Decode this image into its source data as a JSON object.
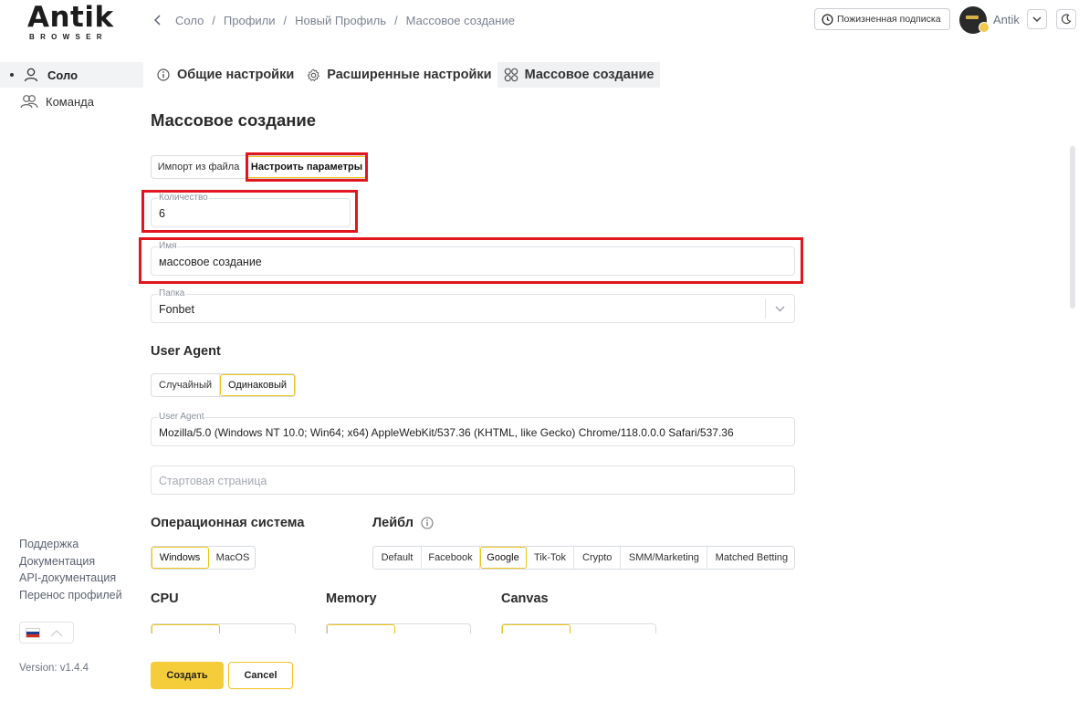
{
  "logo": {
    "word": "Antik",
    "sub": "BROWSER"
  },
  "breadcrumb": [
    "Соло",
    "Профили",
    "Новый Профиль",
    "Массовое создание"
  ],
  "header": {
    "subscription": "Пожизненная подписка",
    "user_name": "Antik"
  },
  "sidebar": {
    "items": [
      {
        "label": "Соло",
        "icon": "user-icon",
        "active": true
      },
      {
        "label": "Команда",
        "icon": "users-icon",
        "active": false
      }
    ],
    "links": [
      "Поддержка",
      "Документация",
      "API-документация",
      "Перенос профилей"
    ],
    "language": "ru",
    "version": "Version: v1.4.4"
  },
  "tabs": [
    {
      "label": "Общие настройки",
      "icon": "info-icon"
    },
    {
      "label": "Расширенные настройки",
      "icon": "gear-icon"
    },
    {
      "label": "Массовое создание",
      "icon": "grid-icon",
      "active": true
    }
  ],
  "page_title": "Массовое создание",
  "import_mode": {
    "options": [
      "Импорт из файла",
      "Настроить параметры"
    ],
    "selected": "Настроить параметры"
  },
  "fields": {
    "quantity": {
      "label": "Количество",
      "value": "6"
    },
    "name": {
      "label": "Имя",
      "value": "массовое создание"
    },
    "folder": {
      "label": "Папка",
      "value": "Fonbet"
    },
    "user_agent": {
      "label": "User Agent",
      "value": "Mozilla/5.0 (Windows NT 10.0; Win64; x64) AppleWebKit/537.36 (KHTML, like Gecko) Chrome/118.0.0.0 Safari/537.36"
    },
    "start_page": {
      "placeholder": "Стартовая страница",
      "value": ""
    }
  },
  "user_agent_section": {
    "title": "User Agent",
    "options": [
      "Случайный",
      "Одинаковый"
    ],
    "selected": "Одинаковый"
  },
  "os_section": {
    "title": "Операционная система",
    "options": [
      "Windows",
      "MacOS"
    ],
    "selected": "Windows"
  },
  "label_section": {
    "title": "Лейбл",
    "options": [
      "Default",
      "Facebook",
      "Google",
      "Tik-Tok",
      "Crypto",
      "SMM/Marketing",
      "Matched Betting"
    ],
    "selected": "Google"
  },
  "cpu_section": {
    "title": "CPU"
  },
  "memory_section": {
    "title": "Memory"
  },
  "canvas_section": {
    "title": "Canvas"
  },
  "actions": {
    "create": "Создать",
    "cancel": "Cancel"
  },
  "colors": {
    "accent": "#f5cd3a",
    "highlight": "#e0161e",
    "active_bg": "#f2f3f5"
  }
}
